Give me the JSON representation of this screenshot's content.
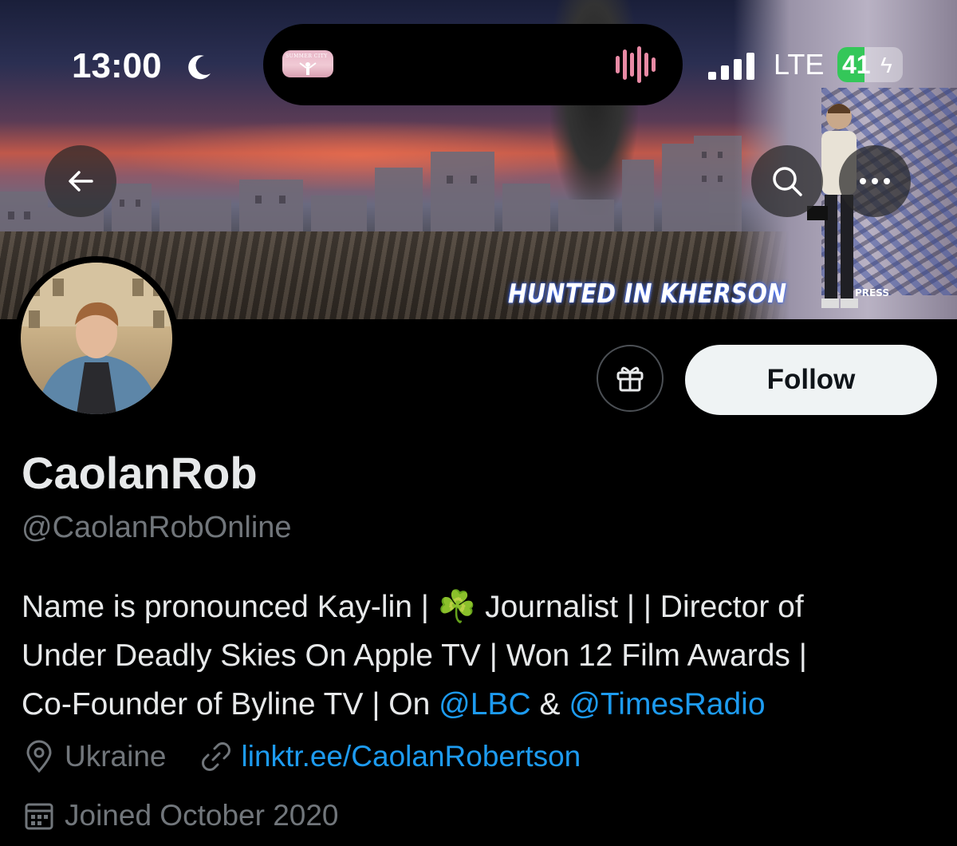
{
  "status_bar": {
    "time": "13:00",
    "network": "LTE",
    "battery_percent": "41",
    "battery_level": 0.41
  },
  "dynamic_island": {
    "art_caption": "SUMMER CITY"
  },
  "banner": {
    "headline": "HUNTED IN KHERSON",
    "press_label": "PRESS"
  },
  "profile": {
    "display_name": "CaolanRob",
    "handle": "@CaolanRobOnline",
    "bio_parts": {
      "line1": "Name is pronounced Kay-lin | ☘️ Journalist | | Director of",
      "line2": "Under Deadly Skies On Apple TV | Won 12 Film Awards |",
      "line3_prefix": "Co-Founder of Byline TV | On ",
      "mention1": "@LBC",
      "and": " & ",
      "mention2": "@TimesRadio"
    },
    "location": "Ukraine",
    "website": "linktr.ee/CaolanRobertson",
    "joined": "Joined October 2020"
  },
  "actions": {
    "follow_label": "Follow"
  },
  "colors": {
    "accent": "#1d9bf0",
    "secondary_text": "#71767b",
    "primary_text": "#e7e9ea",
    "battery": "#34c759"
  },
  "icons": {
    "back": "arrow-left-icon",
    "search": "search-icon",
    "more": "more-horizontal-icon",
    "gift": "gift-icon",
    "location": "location-pin-icon",
    "link": "link-icon",
    "calendar": "calendar-icon"
  }
}
